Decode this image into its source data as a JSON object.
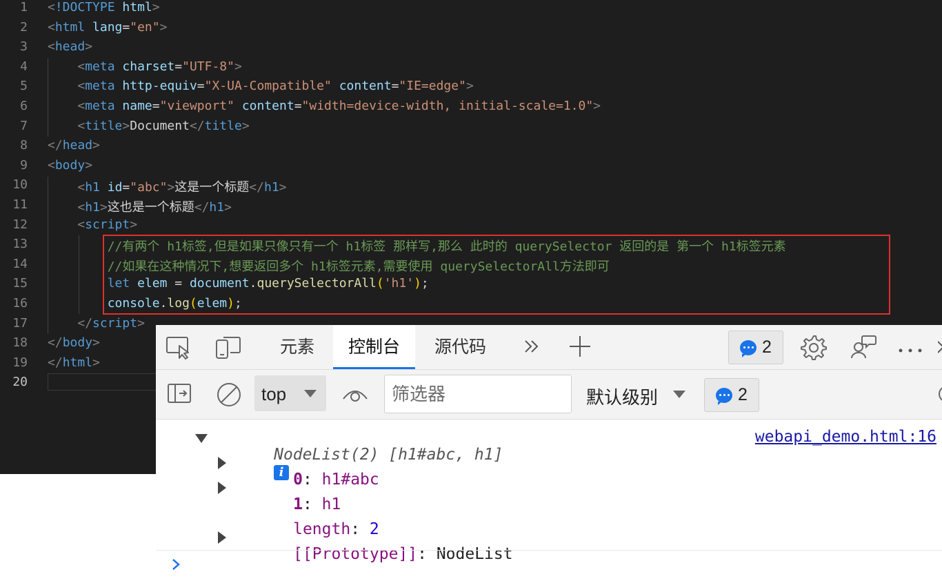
{
  "editor": {
    "line_numbers": [
      "1",
      "2",
      "3",
      "4",
      "5",
      "6",
      "7",
      "8",
      "9",
      "10",
      "11",
      "12",
      "13",
      "14",
      "15",
      "16",
      "17",
      "18",
      "19",
      "20"
    ],
    "lines": [
      [
        [
          "p",
          "<"
        ],
        [
          "t",
          "!DOCTYPE"
        ],
        [
          "tx",
          " "
        ],
        [
          "at",
          "html"
        ],
        [
          "p",
          ">"
        ]
      ],
      [
        [
          "p",
          "<"
        ],
        [
          "t",
          "html"
        ],
        [
          "tx",
          " "
        ],
        [
          "at",
          "lang"
        ],
        [
          "tx",
          "="
        ],
        [
          "s",
          "\"en\""
        ],
        [
          "p",
          ">"
        ]
      ],
      [
        [
          "p",
          "<"
        ],
        [
          "t",
          "head"
        ],
        [
          "p",
          ">"
        ]
      ],
      [
        [
          "tx",
          "    "
        ],
        [
          "p",
          "<"
        ],
        [
          "t",
          "meta"
        ],
        [
          "tx",
          " "
        ],
        [
          "at",
          "charset"
        ],
        [
          "tx",
          "="
        ],
        [
          "s",
          "\"UTF-8\""
        ],
        [
          "p",
          ">"
        ]
      ],
      [
        [
          "tx",
          "    "
        ],
        [
          "p",
          "<"
        ],
        [
          "t",
          "meta"
        ],
        [
          "tx",
          " "
        ],
        [
          "at",
          "http-equiv"
        ],
        [
          "tx",
          "="
        ],
        [
          "s",
          "\"X-UA-Compatible\""
        ],
        [
          "tx",
          " "
        ],
        [
          "at",
          "content"
        ],
        [
          "tx",
          "="
        ],
        [
          "s",
          "\"IE=edge\""
        ],
        [
          "p",
          ">"
        ]
      ],
      [
        [
          "tx",
          "    "
        ],
        [
          "p",
          "<"
        ],
        [
          "t",
          "meta"
        ],
        [
          "tx",
          " "
        ],
        [
          "at",
          "name"
        ],
        [
          "tx",
          "="
        ],
        [
          "s",
          "\"viewport\""
        ],
        [
          "tx",
          " "
        ],
        [
          "at",
          "content"
        ],
        [
          "tx",
          "="
        ],
        [
          "s",
          "\"width=device-width, initial-scale=1.0\""
        ],
        [
          "p",
          ">"
        ]
      ],
      [
        [
          "tx",
          "    "
        ],
        [
          "p",
          "<"
        ],
        [
          "t",
          "title"
        ],
        [
          "p",
          ">"
        ],
        [
          "tx",
          "Document"
        ],
        [
          "p",
          "</"
        ],
        [
          "t",
          "title"
        ],
        [
          "p",
          ">"
        ]
      ],
      [
        [
          "p",
          "</"
        ],
        [
          "t",
          "head"
        ],
        [
          "p",
          ">"
        ]
      ],
      [
        [
          "p",
          "<"
        ],
        [
          "t",
          "body"
        ],
        [
          "p",
          ">"
        ]
      ],
      [
        [
          "tx",
          "    "
        ],
        [
          "p",
          "<"
        ],
        [
          "t",
          "h1"
        ],
        [
          "tx",
          " "
        ],
        [
          "at",
          "id"
        ],
        [
          "tx",
          "="
        ],
        [
          "s",
          "\"abc\""
        ],
        [
          "p",
          ">"
        ],
        [
          "tx",
          "这是一个标题"
        ],
        [
          "p",
          "</"
        ],
        [
          "t",
          "h1"
        ],
        [
          "p",
          ">"
        ]
      ],
      [
        [
          "tx",
          "    "
        ],
        [
          "p",
          "<"
        ],
        [
          "t",
          "h1"
        ],
        [
          "p",
          ">"
        ],
        [
          "tx",
          "这也是一个标题"
        ],
        [
          "p",
          "</"
        ],
        [
          "t",
          "h1"
        ],
        [
          "p",
          ">"
        ]
      ],
      [
        [
          "tx",
          "    "
        ],
        [
          "p",
          "<"
        ],
        [
          "t",
          "script"
        ],
        [
          "p",
          ">"
        ]
      ],
      [
        [
          "tx",
          "        "
        ],
        [
          "c",
          "//有两个 h1标签,但是如果只像只有一个 h1标签 那样写,那么 此时的 querySelector 返回的是 第一个 h1标签元素"
        ]
      ],
      [
        [
          "tx",
          "        "
        ],
        [
          "c",
          "//如果在这种情况下,想要返回多个 h1标签元素,需要使用 querySelectorAll方法即可"
        ]
      ],
      [
        [
          "tx",
          "        "
        ],
        [
          "k",
          "let"
        ],
        [
          "tx",
          " "
        ],
        [
          "v",
          "elem"
        ],
        [
          "tx",
          " = "
        ],
        [
          "v",
          "document"
        ],
        [
          "tx",
          "."
        ],
        [
          "f",
          "querySelectorAll"
        ],
        [
          "b",
          "("
        ],
        [
          "s",
          "'h1'"
        ],
        [
          "b",
          ")"
        ],
        [
          "tx",
          ";"
        ]
      ],
      [
        [
          "tx",
          "        "
        ],
        [
          "v",
          "console"
        ],
        [
          "tx",
          "."
        ],
        [
          "f",
          "log"
        ],
        [
          "b",
          "("
        ],
        [
          "v",
          "elem"
        ],
        [
          "b",
          ")"
        ],
        [
          "tx",
          ";"
        ]
      ],
      [
        [
          "tx",
          "    "
        ],
        [
          "p",
          "</"
        ],
        [
          "t",
          "script"
        ],
        [
          "p",
          ">"
        ]
      ],
      [
        [
          "p",
          "</"
        ],
        [
          "t",
          "body"
        ],
        [
          "p",
          ">"
        ]
      ],
      [
        [
          "p",
          "</"
        ],
        [
          "t",
          "html"
        ],
        [
          "p",
          ">"
        ]
      ],
      [
        [
          "tx",
          ""
        ]
      ]
    ]
  },
  "devtools": {
    "tabs": {
      "elements": "元素",
      "console": "控制台",
      "sources": "源代码"
    },
    "issues_count": "2",
    "context": "top",
    "filter_placeholder": "筛选器",
    "levels": "默认级别",
    "messages_count": "2",
    "console": {
      "summary": "NodeList(2) [h1#abc, h1]",
      "source": "webapi_demo.html:16",
      "items": [
        {
          "key": "0",
          "value": "h1#abc"
        },
        {
          "key": "1",
          "value": "h1"
        }
      ],
      "length_key": "length",
      "length_value": "2",
      "prototype_key": "[[Prototype]]",
      "prototype_value": "NodeList"
    }
  },
  "colors": {
    "accent": "#1a73e8",
    "highlight_box": "#e0302c",
    "editor_bg": "#1e1e1e"
  }
}
